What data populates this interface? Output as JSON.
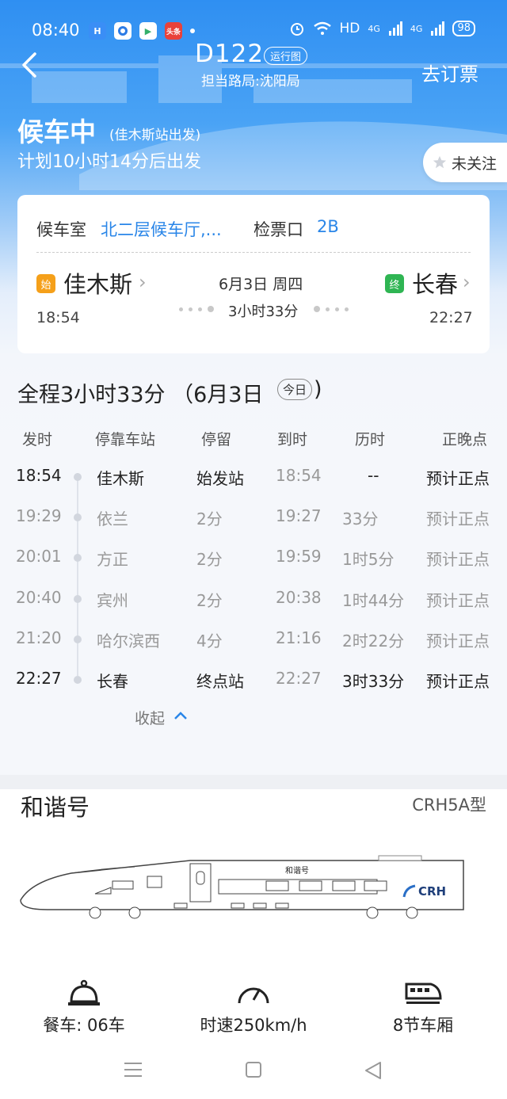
{
  "status_bar": {
    "time": "08:40",
    "apps": [
      {
        "icon": "h-app-icon",
        "label": "H",
        "color": "#3a8ef6"
      },
      {
        "icon": "circle-app-icon",
        "label": "",
        "color": "#2c7be5"
      },
      {
        "icon": "play-app-icon",
        "label": "▶",
        "color": "#34b06a"
      },
      {
        "icon": "toutiao-app-icon",
        "label": "头条",
        "color": "#e9423a"
      }
    ],
    "network": "HD",
    "signal_1": "4G",
    "signal_2": "4G",
    "battery": "98"
  },
  "nav": {
    "train_number": "D122",
    "run_map_label": "运行图",
    "bureau": "担当路局:沈阳局",
    "book_label": "去订票"
  },
  "status": {
    "title": "候车中",
    "subtitle": "(佳木斯站出发)",
    "countdown": "计划10小时14分后出发",
    "follow_label": "未关注"
  },
  "card": {
    "waiting_room_label": "候车室",
    "waiting_room_value": "北二层候车厅,...",
    "gate_label": "检票口",
    "gate_value": "2B",
    "origin": {
      "badge": "始",
      "name": "佳木斯",
      "time": "18:54"
    },
    "destination": {
      "badge": "终",
      "name": "长春",
      "time": "22:27"
    },
    "date": "6月3日 周四",
    "duration": "3小时33分"
  },
  "summary": {
    "text": "全程3小时33分 （6月3日",
    "today_chip": "今日",
    "close": ")"
  },
  "table": {
    "headers": [
      "发时",
      "停靠车站",
      "停留",
      "到时",
      "历时",
      "正晚点"
    ],
    "rows": [
      {
        "depart": "18:54",
        "station": "佳木斯",
        "stop": "始发站",
        "arrive": "18:54",
        "elapsed": "--",
        "status": "预计正点",
        "bold": true
      },
      {
        "depart": "19:29",
        "station": "依兰",
        "stop": "2分",
        "arrive": "19:27",
        "elapsed": "33分",
        "status": "预计正点",
        "bold": false
      },
      {
        "depart": "20:01",
        "station": "方正",
        "stop": "2分",
        "arrive": "19:59",
        "elapsed": "1时5分",
        "status": "预计正点",
        "bold": false
      },
      {
        "depart": "20:40",
        "station": "宾州",
        "stop": "2分",
        "arrive": "20:38",
        "elapsed": "1时44分",
        "status": "预计正点",
        "bold": false
      },
      {
        "depart": "21:20",
        "station": "哈尔滨西",
        "stop": "4分",
        "arrive": "21:16",
        "elapsed": "2时22分",
        "status": "预计正点",
        "bold": false
      },
      {
        "depart": "22:27",
        "station": "长春",
        "stop": "终点站",
        "arrive": "22:27",
        "elapsed": "3时33分",
        "status": "预计正点",
        "bold": true
      }
    ],
    "collapse_label": "收起"
  },
  "train_info": {
    "series": "和谐号",
    "model": "CRH5A型",
    "livery_text": "和谐号",
    "brand": "CRH",
    "features": [
      {
        "icon": "dining-bell-icon",
        "label": "餐车: 06车"
      },
      {
        "icon": "speedometer-icon",
        "label": "时速250km/h"
      },
      {
        "icon": "train-car-icon",
        "label": "8节车厢"
      }
    ]
  },
  "colors": {
    "accent_blue": "#2a86e8",
    "origin_badge": "#f5a01a",
    "destination_badge": "#2fb553"
  }
}
